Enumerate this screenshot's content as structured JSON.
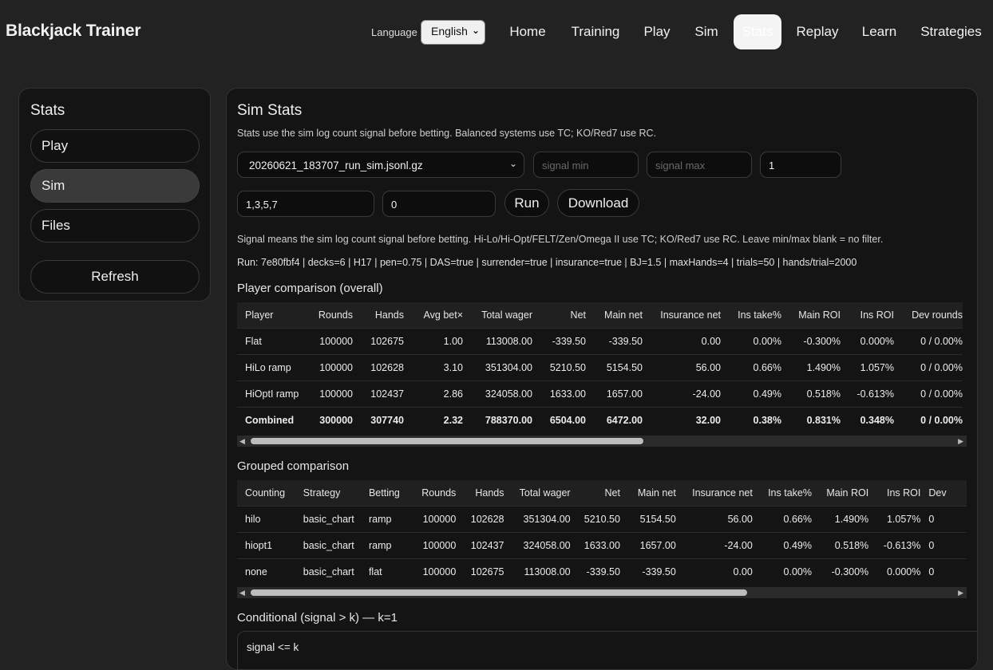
{
  "app": {
    "title": "Blackjack Trainer",
    "language_label": "Language",
    "language_value": "English"
  },
  "nav": [
    "Home",
    "Training",
    "Play",
    "Sim",
    "Stats",
    "Replay",
    "Learn",
    "Strategies"
  ],
  "nav_active": "Stats",
  "sidebar": {
    "title": "Stats",
    "items": [
      "Play",
      "Sim",
      "Files"
    ],
    "active": "Sim",
    "refresh_label": "Refresh"
  },
  "main": {
    "title": "Sim Stats",
    "intro": "Stats use the sim log count signal before betting. Balanced systems use TC; KO/Red7 use RC.",
    "file_select": "20260621_183707_run_sim.jsonl.gz",
    "signal_min_placeholder": "signal min",
    "signal_max_placeholder": "signal max",
    "k_value": "1",
    "ramp_value": "1,3,5,7",
    "offset_value": "0",
    "run_label": "Run",
    "download_label": "Download",
    "signal_note": "Signal means the sim log count signal before betting. Hi-Lo/Hi-Opt/FELT/Zen/Omega II use TC; KO/Red7 use RC. Leave min/max blank = no filter.",
    "run_info": "Run: 7e80fbf4 | decks=6 | H17 | pen=0.75 | DAS=true | surrender=true | insurance=true | BJ=1.5 | maxHands=4 | trials=50 | hands/trial=2000"
  },
  "player_table": {
    "title": "Player comparison (overall)",
    "columns": [
      "Player",
      "Rounds",
      "Hands",
      "Avg bet×",
      "Total wager",
      "Net",
      "Main net",
      "Insurance net",
      "Ins take%",
      "Main ROI",
      "Ins ROI",
      "Dev rounds"
    ],
    "rows": [
      [
        "Flat",
        "100000",
        "102675",
        "1.00",
        "113008.00",
        "-339.50",
        "-339.50",
        "0.00",
        "0.00%",
        "-0.300%",
        "0.000%",
        "0 / 0.00%"
      ],
      [
        "HiLo ramp",
        "100000",
        "102628",
        "3.10",
        "351304.00",
        "5210.50",
        "5154.50",
        "56.00",
        "0.66%",
        "1.490%",
        "1.057%",
        "0 / 0.00%"
      ],
      [
        "HiOptI ramp",
        "100000",
        "102437",
        "2.86",
        "324058.00",
        "1633.00",
        "1657.00",
        "-24.00",
        "0.49%",
        "0.518%",
        "-0.613%",
        "0 / 0.00%"
      ],
      [
        "Combined",
        "300000",
        "307740",
        "2.32",
        "788370.00",
        "6504.00",
        "6472.00",
        "32.00",
        "0.38%",
        "0.831%",
        "0.348%",
        "0 / 0.00%"
      ]
    ]
  },
  "grouped_table": {
    "title": "Grouped comparison",
    "columns": [
      "Counting",
      "Strategy",
      "Betting",
      "Rounds",
      "Hands",
      "Total wager",
      "Net",
      "Main net",
      "Insurance net",
      "Ins take%",
      "Main ROI",
      "Ins ROI",
      "Dev"
    ],
    "rows": [
      [
        "hilo",
        "basic_chart",
        "ramp",
        "100000",
        "102628",
        "351304.00",
        "5210.50",
        "5154.50",
        "56.00",
        "0.66%",
        "1.490%",
        "1.057%",
        "0"
      ],
      [
        "hiopt1",
        "basic_chart",
        "ramp",
        "100000",
        "102437",
        "324058.00",
        "1633.00",
        "1657.00",
        "-24.00",
        "0.49%",
        "0.518%",
        "-0.613%",
        "0"
      ],
      [
        "none",
        "basic_chart",
        "flat",
        "100000",
        "102675",
        "113008.00",
        "-339.50",
        "-339.50",
        "0.00",
        "0.00%",
        "-0.300%",
        "0.000%",
        "0"
      ]
    ]
  },
  "conditional": {
    "title": "Conditional (signal > k) — k=1",
    "first_row": "signal <= k"
  }
}
